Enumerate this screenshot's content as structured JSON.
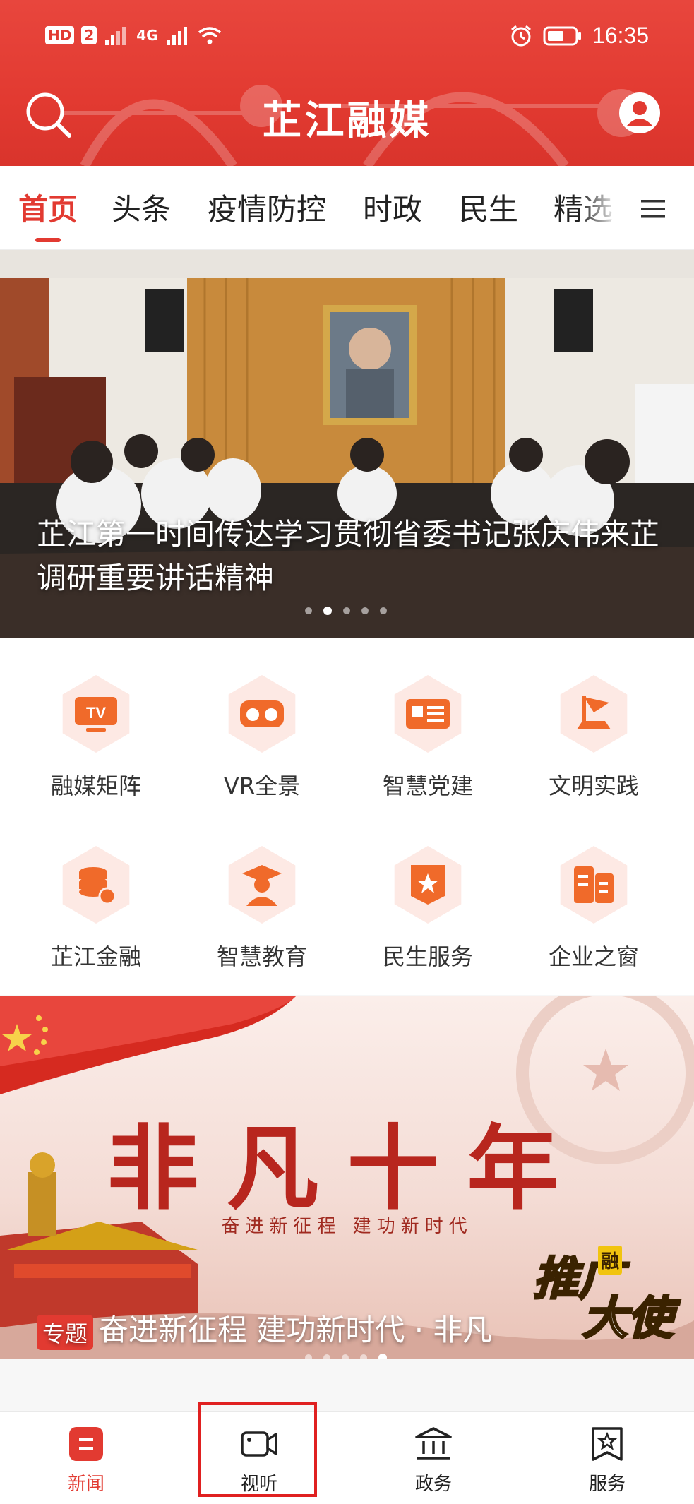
{
  "status_bar": {
    "left_badges": [
      "HD",
      "2"
    ],
    "network": "4G",
    "time": "16:35"
  },
  "header": {
    "title": "芷江融媒",
    "search_icon": "search-icon",
    "user_icon": "user-icon"
  },
  "tabs": {
    "items": [
      "首页",
      "头条",
      "疫情防控",
      "时政",
      "民生",
      "精选"
    ],
    "active_index": 0,
    "menu_icon": "hamburger-menu-icon"
  },
  "hero": {
    "title": "芷江第一时间传达学习贯彻省委书记张庆伟来芷调研重要讲话精神",
    "slide_count": 5,
    "active_slide": 1
  },
  "features": {
    "items": [
      {
        "label": "融媒矩阵",
        "icon": "tv-icon"
      },
      {
        "label": "VR全景",
        "icon": "vr-glasses-icon"
      },
      {
        "label": "智慧党建",
        "icon": "party-card-icon"
      },
      {
        "label": "文明实践",
        "icon": "flag-icon"
      },
      {
        "label": "芷江金融",
        "icon": "coin-stack-icon"
      },
      {
        "label": "智慧教育",
        "icon": "graduate-icon"
      },
      {
        "label": "民生服务",
        "icon": "star-badge-icon"
      },
      {
        "label": "企业之窗",
        "icon": "building-icon"
      }
    ]
  },
  "banner": {
    "headline": "非凡十年",
    "subheadline": "奋进新征程 建功新时代",
    "tag": "专题",
    "caption": "奋进新征程 建功新时代 · 非凡",
    "badge_main_1": "推广",
    "badge_main_2": "大使",
    "badge_small": "融",
    "slide_count": 5,
    "active_slide": 4
  },
  "bottom_nav": {
    "items": [
      {
        "label": "新闻",
        "icon": "news-icon"
      },
      {
        "label": "视听",
        "icon": "video-camera-icon"
      },
      {
        "label": "政务",
        "icon": "government-building-icon"
      },
      {
        "label": "服务",
        "icon": "service-star-icon"
      }
    ],
    "active_index": 0,
    "highlighted_index": 1
  },
  "colors": {
    "brand_red": "#e23a31",
    "icon_orange": "#f06a2a",
    "icon_bg": "#fde9e4"
  }
}
